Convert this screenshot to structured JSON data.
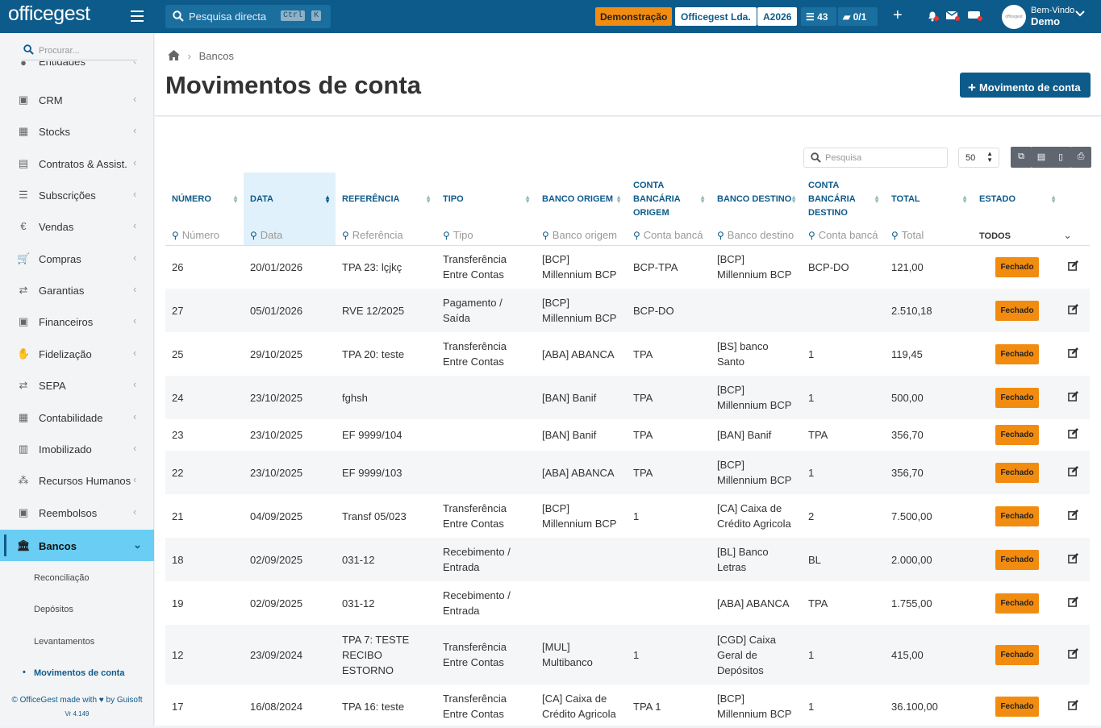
{
  "topbar": {
    "logo": "officegest",
    "search_label": "Pesquisa directa",
    "kbd_ctrl": "Ctrl",
    "kbd_k": "K",
    "demo_badge": "Demonstração",
    "company_badge": "Officegest Lda.",
    "year_badge": "A2026",
    "tasks_count": "43",
    "folders_count": "0/1",
    "welcome_label": "Bem-Vindo",
    "user_name": "Demo"
  },
  "sidebar": {
    "search_placeholder": "Procurar...",
    "partial_item": "Entidades",
    "items": [
      {
        "label": "CRM",
        "icon": "briefcase-icon"
      },
      {
        "label": "Stocks",
        "icon": "boxes-icon"
      },
      {
        "label": "Contratos & Assist.",
        "icon": "contract-icon"
      },
      {
        "label": "Subscrições",
        "icon": "list-icon"
      },
      {
        "label": "Vendas",
        "icon": "euro-icon"
      },
      {
        "label": "Compras",
        "icon": "cart-icon"
      },
      {
        "label": "Garantias",
        "icon": "exchange-icon"
      },
      {
        "label": "Financeiros",
        "icon": "money-icon"
      },
      {
        "label": "Fidelização",
        "icon": "hand-icon"
      },
      {
        "label": "SEPA",
        "icon": "exchange-icon"
      },
      {
        "label": "Contabilidade",
        "icon": "calculator-icon"
      },
      {
        "label": "Imobilizado",
        "icon": "building-icon"
      },
      {
        "label": "Recursos Humanos",
        "icon": "people-icon"
      },
      {
        "label": "Reembolsos",
        "icon": "money-icon"
      },
      {
        "label": "Bancos",
        "icon": "bank-icon"
      }
    ],
    "subitems": [
      "Reconciliação",
      "Depósitos",
      "Levantamentos",
      "Movimentos de conta"
    ],
    "footer_line1": "© OfficeGest made with",
    "footer_by": "by Guisoft",
    "footer_version": "Vr 4.149"
  },
  "page": {
    "breadcrumb": "Bancos",
    "title": "Movimentos de conta",
    "new_button": "Movimento de conta"
  },
  "toolbar": {
    "search_placeholder": "Pesquisa",
    "page_size": "50"
  },
  "table": {
    "headers": [
      "NÚMERO",
      "DATA",
      "REFERÊNCIA",
      "TIPO",
      "BANCO ORIGEM",
      "CONTA BANCÁRIA ORIGEM",
      "BANCO DESTINO",
      "CONTA BANCÁRIA DESTINO",
      "TOTAL",
      "ESTADO"
    ],
    "filters": [
      "Número",
      "Data",
      "Referência",
      "Tipo",
      "Banco origem",
      "Conta bancá",
      "Banco destino",
      "Conta bancá",
      "Total"
    ],
    "estado_filter": "TODOS",
    "rows": [
      {
        "num": "26",
        "data": "20/01/2026",
        "ref": "TPA 23: lçjkç",
        "tipo": "Transferência Entre Contas",
        "borig": "[BCP] Millennium BCP",
        "corig": "BCP-TPA",
        "bdest": "[BCP] Millennium BCP",
        "cdest": "BCP-DO",
        "total": "121,00",
        "estado": "Fechado"
      },
      {
        "num": "27",
        "data": "05/01/2026",
        "ref": "RVE 12/2025",
        "tipo": "Pagamento / Saída",
        "borig": "[BCP] Millennium BCP",
        "corig": "BCP-DO",
        "bdest": "",
        "cdest": "",
        "total": "2.510,18",
        "estado": "Fechado"
      },
      {
        "num": "25",
        "data": "29/10/2025",
        "ref": "TPA 20: teste",
        "tipo": "Transferência Entre Contas",
        "borig": "[ABA] ABANCA",
        "corig": "TPA",
        "bdest": "[BS] banco Santo",
        "cdest": "1",
        "total": "119,45",
        "estado": "Fechado"
      },
      {
        "num": "24",
        "data": "23/10/2025",
        "ref": "fghsh",
        "tipo": "",
        "borig": "[BAN] Banif",
        "corig": "TPA",
        "bdest": "[BCP] Millennium BCP",
        "cdest": "1",
        "total": "500,00",
        "estado": "Fechado"
      },
      {
        "num": "23",
        "data": "23/10/2025",
        "ref": "EF 9999/104",
        "tipo": "",
        "borig": "[BAN] Banif",
        "corig": "TPA",
        "bdest": "[BAN] Banif",
        "cdest": "TPA",
        "total": "356,70",
        "estado": "Fechado"
      },
      {
        "num": "22",
        "data": "23/10/2025",
        "ref": "EF 9999/103",
        "tipo": "",
        "borig": "[ABA] ABANCA",
        "corig": "TPA",
        "bdest": "[BCP] Millennium BCP",
        "cdest": "1",
        "total": "356,70",
        "estado": "Fechado"
      },
      {
        "num": "21",
        "data": "04/09/2025",
        "ref": "Transf 05/023",
        "tipo": "Transferência Entre Contas",
        "borig": "[BCP] Millennium BCP",
        "corig": "1",
        "bdest": "[CA] Caixa de Crédito Agricola",
        "cdest": "2",
        "total": "7.500,00",
        "estado": "Fechado"
      },
      {
        "num": "18",
        "data": "02/09/2025",
        "ref": "031-12",
        "tipo": "Recebimento / Entrada",
        "borig": "",
        "corig": "",
        "bdest": "[BL] Banco Letras",
        "cdest": "BL",
        "total": "2.000,00",
        "estado": "Fechado"
      },
      {
        "num": "19",
        "data": "02/09/2025",
        "ref": "031-12",
        "tipo": "Recebimento / Entrada",
        "borig": "",
        "corig": "",
        "bdest": "[ABA] ABANCA",
        "cdest": "TPA",
        "total": "1.755,00",
        "estado": "Fechado"
      },
      {
        "num": "12",
        "data": "23/09/2024",
        "ref": "TPA 7: TESTE RECIBO ESTORNO",
        "tipo": "Transferência Entre Contas",
        "borig": "[MUL] Multibanco",
        "corig": "1",
        "bdest": "[CGD] Caixa Geral de Depósitos",
        "cdest": "1",
        "total": "415,00",
        "estado": "Fechado"
      },
      {
        "num": "17",
        "data": "16/08/2024",
        "ref": "TPA 16: teste",
        "tipo": "Transferência Entre Contas",
        "borig": "[CA] Caixa de Crédito Agricola",
        "corig": "TPA 1",
        "bdest": "[BCP] Millennium BCP",
        "cdest": "1",
        "total": "36.100,00",
        "estado": "Fechado"
      }
    ]
  },
  "colors": {
    "primary": "#0d5b8b",
    "accent": "#69cdf4",
    "warning": "#f28c10"
  }
}
